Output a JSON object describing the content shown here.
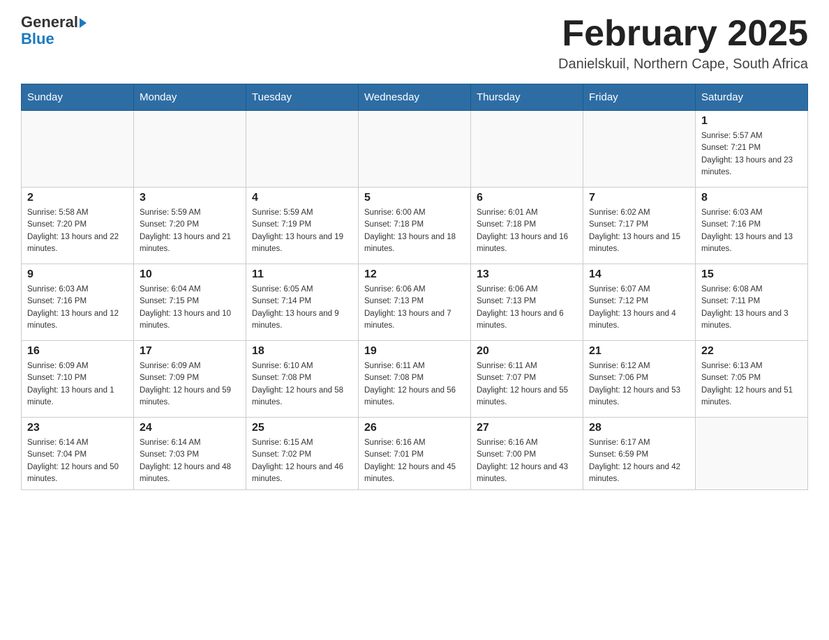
{
  "header": {
    "logo_general": "General",
    "logo_blue": "Blue",
    "month_title": "February 2025",
    "location": "Danielskuil, Northern Cape, South Africa"
  },
  "weekdays": [
    "Sunday",
    "Monday",
    "Tuesday",
    "Wednesday",
    "Thursday",
    "Friday",
    "Saturday"
  ],
  "weeks": [
    [
      {
        "day": "",
        "info": ""
      },
      {
        "day": "",
        "info": ""
      },
      {
        "day": "",
        "info": ""
      },
      {
        "day": "",
        "info": ""
      },
      {
        "day": "",
        "info": ""
      },
      {
        "day": "",
        "info": ""
      },
      {
        "day": "1",
        "info": "Sunrise: 5:57 AM\nSunset: 7:21 PM\nDaylight: 13 hours and 23 minutes."
      }
    ],
    [
      {
        "day": "2",
        "info": "Sunrise: 5:58 AM\nSunset: 7:20 PM\nDaylight: 13 hours and 22 minutes."
      },
      {
        "day": "3",
        "info": "Sunrise: 5:59 AM\nSunset: 7:20 PM\nDaylight: 13 hours and 21 minutes."
      },
      {
        "day": "4",
        "info": "Sunrise: 5:59 AM\nSunset: 7:19 PM\nDaylight: 13 hours and 19 minutes."
      },
      {
        "day": "5",
        "info": "Sunrise: 6:00 AM\nSunset: 7:18 PM\nDaylight: 13 hours and 18 minutes."
      },
      {
        "day": "6",
        "info": "Sunrise: 6:01 AM\nSunset: 7:18 PM\nDaylight: 13 hours and 16 minutes."
      },
      {
        "day": "7",
        "info": "Sunrise: 6:02 AM\nSunset: 7:17 PM\nDaylight: 13 hours and 15 minutes."
      },
      {
        "day": "8",
        "info": "Sunrise: 6:03 AM\nSunset: 7:16 PM\nDaylight: 13 hours and 13 minutes."
      }
    ],
    [
      {
        "day": "9",
        "info": "Sunrise: 6:03 AM\nSunset: 7:16 PM\nDaylight: 13 hours and 12 minutes."
      },
      {
        "day": "10",
        "info": "Sunrise: 6:04 AM\nSunset: 7:15 PM\nDaylight: 13 hours and 10 minutes."
      },
      {
        "day": "11",
        "info": "Sunrise: 6:05 AM\nSunset: 7:14 PM\nDaylight: 13 hours and 9 minutes."
      },
      {
        "day": "12",
        "info": "Sunrise: 6:06 AM\nSunset: 7:13 PM\nDaylight: 13 hours and 7 minutes."
      },
      {
        "day": "13",
        "info": "Sunrise: 6:06 AM\nSunset: 7:13 PM\nDaylight: 13 hours and 6 minutes."
      },
      {
        "day": "14",
        "info": "Sunrise: 6:07 AM\nSunset: 7:12 PM\nDaylight: 13 hours and 4 minutes."
      },
      {
        "day": "15",
        "info": "Sunrise: 6:08 AM\nSunset: 7:11 PM\nDaylight: 13 hours and 3 minutes."
      }
    ],
    [
      {
        "day": "16",
        "info": "Sunrise: 6:09 AM\nSunset: 7:10 PM\nDaylight: 13 hours and 1 minute."
      },
      {
        "day": "17",
        "info": "Sunrise: 6:09 AM\nSunset: 7:09 PM\nDaylight: 12 hours and 59 minutes."
      },
      {
        "day": "18",
        "info": "Sunrise: 6:10 AM\nSunset: 7:08 PM\nDaylight: 12 hours and 58 minutes."
      },
      {
        "day": "19",
        "info": "Sunrise: 6:11 AM\nSunset: 7:08 PM\nDaylight: 12 hours and 56 minutes."
      },
      {
        "day": "20",
        "info": "Sunrise: 6:11 AM\nSunset: 7:07 PM\nDaylight: 12 hours and 55 minutes."
      },
      {
        "day": "21",
        "info": "Sunrise: 6:12 AM\nSunset: 7:06 PM\nDaylight: 12 hours and 53 minutes."
      },
      {
        "day": "22",
        "info": "Sunrise: 6:13 AM\nSunset: 7:05 PM\nDaylight: 12 hours and 51 minutes."
      }
    ],
    [
      {
        "day": "23",
        "info": "Sunrise: 6:14 AM\nSunset: 7:04 PM\nDaylight: 12 hours and 50 minutes."
      },
      {
        "day": "24",
        "info": "Sunrise: 6:14 AM\nSunset: 7:03 PM\nDaylight: 12 hours and 48 minutes."
      },
      {
        "day": "25",
        "info": "Sunrise: 6:15 AM\nSunset: 7:02 PM\nDaylight: 12 hours and 46 minutes."
      },
      {
        "day": "26",
        "info": "Sunrise: 6:16 AM\nSunset: 7:01 PM\nDaylight: 12 hours and 45 minutes."
      },
      {
        "day": "27",
        "info": "Sunrise: 6:16 AM\nSunset: 7:00 PM\nDaylight: 12 hours and 43 minutes."
      },
      {
        "day": "28",
        "info": "Sunrise: 6:17 AM\nSunset: 6:59 PM\nDaylight: 12 hours and 42 minutes."
      },
      {
        "day": "",
        "info": ""
      }
    ]
  ]
}
